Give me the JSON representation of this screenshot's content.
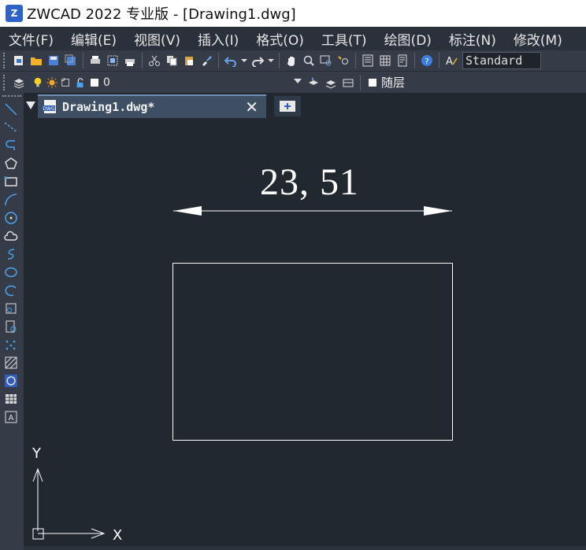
{
  "window": {
    "logo_glyph": "Z",
    "title": "ZWCAD 2022 专业版 - [Drawing1.dwg]"
  },
  "menu": {
    "items": [
      "文件(F)",
      "编辑(E)",
      "视图(V)",
      "插入(I)",
      "格式(O)",
      "工具(T)",
      "绘图(D)",
      "标注(N)",
      "修改(M)"
    ]
  },
  "toolbar": {
    "text_style": "Standard",
    "layer_value": "0",
    "color_value": "随层"
  },
  "tabs": {
    "document_title": "Drawing1.dwg*",
    "close_glyph": "✕"
  },
  "drawing": {
    "dimension_text": "23, 51",
    "ucs_x_label": "X",
    "ucs_y_label": "Y"
  },
  "colors": {
    "canvas_bg": "#212830",
    "toolbar_bg": "#353c47",
    "menubar_bg": "#2a313b",
    "tab_active": "#3f4f63",
    "entity_white": "#ffffff"
  }
}
